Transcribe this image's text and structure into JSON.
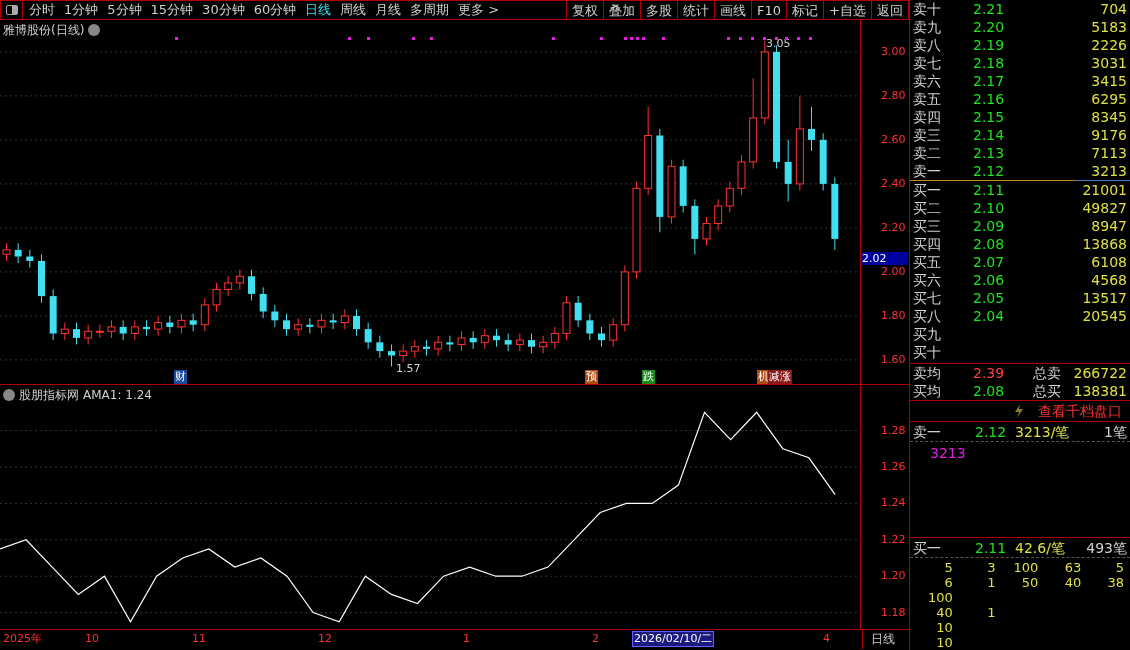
{
  "toolbar": {
    "periods": [
      {
        "label": "分时",
        "selected": false
      },
      {
        "label": "1分钟",
        "selected": false
      },
      {
        "label": "5分钟",
        "selected": false
      },
      {
        "label": "15分钟",
        "selected": false
      },
      {
        "label": "30分钟",
        "selected": false
      },
      {
        "label": "60分钟",
        "selected": false
      },
      {
        "label": "日线",
        "selected": true
      },
      {
        "label": "周线",
        "selected": false
      },
      {
        "label": "月线",
        "selected": false
      },
      {
        "label": "多周期",
        "selected": false
      },
      {
        "label": "更多 >",
        "selected": false
      }
    ],
    "actions": [
      "复权",
      "叠加",
      "多股",
      "统计",
      "画线",
      "F10",
      "标记",
      "+自选",
      "返回"
    ]
  },
  "price_chart": {
    "title": "雅博股份(日线)",
    "current_price": "2.02",
    "high_label": "3.05",
    "low_label": "1.57",
    "events": [
      {
        "label": "财",
        "color": "#1a4a9a"
      },
      {
        "label": "预",
        "color": "#b04a10"
      },
      {
        "label": "跌",
        "color": "#1a8a1a"
      },
      {
        "label": "机",
        "color": "#b04a10"
      },
      {
        "label": "减",
        "color": "#8a1a1a"
      },
      {
        "label": "涨",
        "color": "#8a1a1a"
      }
    ],
    "chart_data": {
      "type": "candlestick",
      "ylim": [
        1.486,
        3.145
      ],
      "grid": true,
      "yticks": [
        {
          "value": 3.0,
          "label": "3.00"
        },
        {
          "value": 2.8,
          "label": "2.80"
        },
        {
          "value": 2.6,
          "label": "2.60"
        },
        {
          "value": 2.4,
          "label": "2.40"
        },
        {
          "value": 2.2,
          "label": "2.20"
        },
        {
          "value": 2.0,
          "label": "2.00"
        },
        {
          "value": 1.8,
          "label": "1.80"
        },
        {
          "value": 1.6,
          "label": "1.60"
        }
      ],
      "ohlc": [
        [
          2.08,
          2.13,
          2.05,
          2.1
        ],
        [
          2.1,
          2.13,
          2.04,
          2.07
        ],
        [
          2.07,
          2.1,
          2.02,
          2.05
        ],
        [
          2.05,
          2.08,
          1.86,
          1.89
        ],
        [
          1.89,
          1.92,
          1.69,
          1.72
        ],
        [
          1.72,
          1.77,
          1.69,
          1.74
        ],
        [
          1.74,
          1.77,
          1.67,
          1.7
        ],
        [
          1.7,
          1.76,
          1.67,
          1.73
        ],
        [
          1.73,
          1.76,
          1.7,
          1.73
        ],
        [
          1.73,
          1.78,
          1.7,
          1.75
        ],
        [
          1.75,
          1.78,
          1.69,
          1.72
        ],
        [
          1.72,
          1.78,
          1.69,
          1.75
        ],
        [
          1.75,
          1.78,
          1.71,
          1.74
        ],
        [
          1.74,
          1.8,
          1.71,
          1.77
        ],
        [
          1.77,
          1.8,
          1.72,
          1.75
        ],
        [
          1.75,
          1.81,
          1.72,
          1.78
        ],
        [
          1.78,
          1.81,
          1.73,
          1.76
        ],
        [
          1.76,
          1.88,
          1.73,
          1.85
        ],
        [
          1.85,
          1.95,
          1.82,
          1.92
        ],
        [
          1.92,
          1.98,
          1.89,
          1.95
        ],
        [
          1.95,
          2.01,
          1.92,
          1.98
        ],
        [
          1.98,
          2.01,
          1.87,
          1.9
        ],
        [
          1.9,
          1.93,
          1.79,
          1.82
        ],
        [
          1.82,
          1.85,
          1.75,
          1.78
        ],
        [
          1.78,
          1.81,
          1.71,
          1.74
        ],
        [
          1.74,
          1.79,
          1.71,
          1.76
        ],
        [
          1.76,
          1.79,
          1.72,
          1.75
        ],
        [
          1.75,
          1.81,
          1.72,
          1.78
        ],
        [
          1.78,
          1.81,
          1.74,
          1.77
        ],
        [
          1.77,
          1.83,
          1.74,
          1.8
        ],
        [
          1.8,
          1.83,
          1.71,
          1.74
        ],
        [
          1.74,
          1.77,
          1.65,
          1.68
        ],
        [
          1.68,
          1.71,
          1.61,
          1.64
        ],
        [
          1.64,
          1.67,
          1.57,
          1.62
        ],
        [
          1.62,
          1.67,
          1.59,
          1.64
        ],
        [
          1.64,
          1.69,
          1.61,
          1.66
        ],
        [
          1.66,
          1.69,
          1.62,
          1.65
        ],
        [
          1.65,
          1.71,
          1.62,
          1.68
        ],
        [
          1.68,
          1.71,
          1.64,
          1.67
        ],
        [
          1.67,
          1.73,
          1.64,
          1.7
        ],
        [
          1.7,
          1.73,
          1.65,
          1.68
        ],
        [
          1.68,
          1.74,
          1.65,
          1.71
        ],
        [
          1.71,
          1.74,
          1.66,
          1.69
        ],
        [
          1.69,
          1.72,
          1.64,
          1.67
        ],
        [
          1.67,
          1.72,
          1.64,
          1.69
        ],
        [
          1.69,
          1.72,
          1.63,
          1.66
        ],
        [
          1.66,
          1.71,
          1.63,
          1.68
        ],
        [
          1.68,
          1.75,
          1.65,
          1.72
        ],
        [
          1.72,
          1.89,
          1.69,
          1.86
        ],
        [
          1.86,
          1.89,
          1.75,
          1.78
        ],
        [
          1.78,
          1.81,
          1.69,
          1.72
        ],
        [
          1.72,
          1.75,
          1.66,
          1.69
        ],
        [
          1.69,
          1.79,
          1.66,
          1.76
        ],
        [
          1.76,
          2.03,
          1.73,
          2.0
        ],
        [
          2.0,
          2.41,
          1.97,
          2.38
        ],
        [
          2.38,
          2.75,
          2.35,
          2.62
        ],
        [
          2.62,
          2.65,
          2.18,
          2.25
        ],
        [
          2.25,
          2.51,
          2.22,
          2.48
        ],
        [
          2.48,
          2.51,
          2.27,
          2.3
        ],
        [
          2.3,
          2.33,
          2.08,
          2.15
        ],
        [
          2.15,
          2.25,
          2.12,
          2.22
        ],
        [
          2.22,
          2.33,
          2.19,
          2.3
        ],
        [
          2.3,
          2.41,
          2.27,
          2.38
        ],
        [
          2.38,
          2.53,
          2.35,
          2.5
        ],
        [
          2.5,
          2.88,
          2.47,
          2.7
        ],
        [
          2.7,
          3.05,
          2.67,
          3.0
        ],
        [
          3.0,
          3.03,
          2.47,
          2.5
        ],
        [
          2.5,
          2.6,
          2.32,
          2.4
        ],
        [
          2.4,
          2.8,
          2.37,
          2.65
        ],
        [
          2.65,
          2.75,
          2.55,
          2.6
        ],
        [
          2.6,
          2.63,
          2.37,
          2.4
        ],
        [
          2.4,
          2.43,
          2.1,
          2.15
        ]
      ]
    }
  },
  "indicator": {
    "title": "股朋指标网",
    "reading": ": 1.24",
    "chart_data": {
      "type": "line",
      "ylim": [
        1.171,
        1.305
      ],
      "grid": true,
      "series": [
        {
          "name": "AMA1",
          "color": "#ffffff",
          "values": [
            1.215,
            1.22,
            1.205,
            1.19,
            1.2,
            1.175,
            1.2,
            1.21,
            1.215,
            1.205,
            1.21,
            1.2,
            1.18,
            1.175,
            1.2,
            1.19,
            1.185,
            1.2,
            1.205,
            1.2,
            1.2,
            1.205,
            1.22,
            1.235,
            1.24,
            1.24,
            1.25,
            1.29,
            1.275,
            1.29,
            1.27,
            1.265,
            1.245
          ]
        }
      ],
      "yticks": [
        {
          "value": 1.28,
          "label": "1.28"
        },
        {
          "value": 1.26,
          "label": "1.26"
        },
        {
          "value": 1.24,
          "label": "1.24"
        },
        {
          "value": 1.22,
          "label": "1.22"
        },
        {
          "value": 1.2,
          "label": "1.20"
        },
        {
          "value": 1.18,
          "label": "1.18"
        }
      ]
    }
  },
  "date_axis": {
    "labels": [
      "2025年",
      "10",
      "11",
      "12",
      "1",
      "2",
      "4"
    ],
    "cursor_date": "2026/02/10/二",
    "period": "日线"
  },
  "order_book": {
    "asks": [
      {
        "label": "卖十",
        "price": "2.21",
        "volume": "704"
      },
      {
        "label": "卖九",
        "price": "2.20",
        "volume": "5183"
      },
      {
        "label": "卖八",
        "price": "2.19",
        "volume": "2226"
      },
      {
        "label": "卖七",
        "price": "2.18",
        "volume": "3031"
      },
      {
        "label": "卖六",
        "price": "2.17",
        "volume": "3415"
      },
      {
        "label": "卖五",
        "price": "2.16",
        "volume": "6295"
      },
      {
        "label": "卖四",
        "price": "2.15",
        "volume": "8345"
      },
      {
        "label": "卖三",
        "price": "2.14",
        "volume": "9176"
      },
      {
        "label": "卖二",
        "price": "2.13",
        "volume": "7113"
      },
      {
        "label": "卖一",
        "price": "2.12",
        "volume": "3213"
      }
    ],
    "bids": [
      {
        "label": "买一",
        "price": "2.11",
        "volume": "21001"
      },
      {
        "label": "买二",
        "price": "2.10",
        "volume": "49827"
      },
      {
        "label": "买三",
        "price": "2.09",
        "volume": "8947"
      },
      {
        "label": "买四",
        "price": "2.08",
        "volume": "13868"
      },
      {
        "label": "买五",
        "price": "2.07",
        "volume": "6108"
      },
      {
        "label": "买六",
        "price": "2.06",
        "volume": "4568"
      },
      {
        "label": "买七",
        "price": "2.05",
        "volume": "13517"
      },
      {
        "label": "买八",
        "price": "2.04",
        "volume": "20545"
      },
      {
        "label": "买九"
      },
      {
        "label": "买十"
      }
    ],
    "averages": [
      {
        "label": "卖均",
        "price": "2.39",
        "color": "#ff4040",
        "total_label": "总卖",
        "total": "266722"
      },
      {
        "label": "买均",
        "price": "2.08",
        "color": "#20e020",
        "total_label": "总买",
        "total": "138381"
      }
    ],
    "depth_link": "查看千档盘口",
    "ask_queue": {
      "label": "卖一",
      "price": "2.12",
      "avg": "3213/笔",
      "count": "1笔",
      "orders": [
        "3213"
      ]
    },
    "bid_queue": {
      "label": "买一",
      "price": "2.11",
      "avg": "42.6/笔",
      "count": "493笔",
      "rows": [
        [
          "5",
          "3",
          "100",
          "63",
          "5"
        ],
        [
          "6",
          "1",
          "50",
          "40",
          "38"
        ],
        [
          "100"
        ],
        [
          "40",
          "1"
        ],
        [
          "10"
        ],
        [
          "10"
        ]
      ]
    }
  }
}
